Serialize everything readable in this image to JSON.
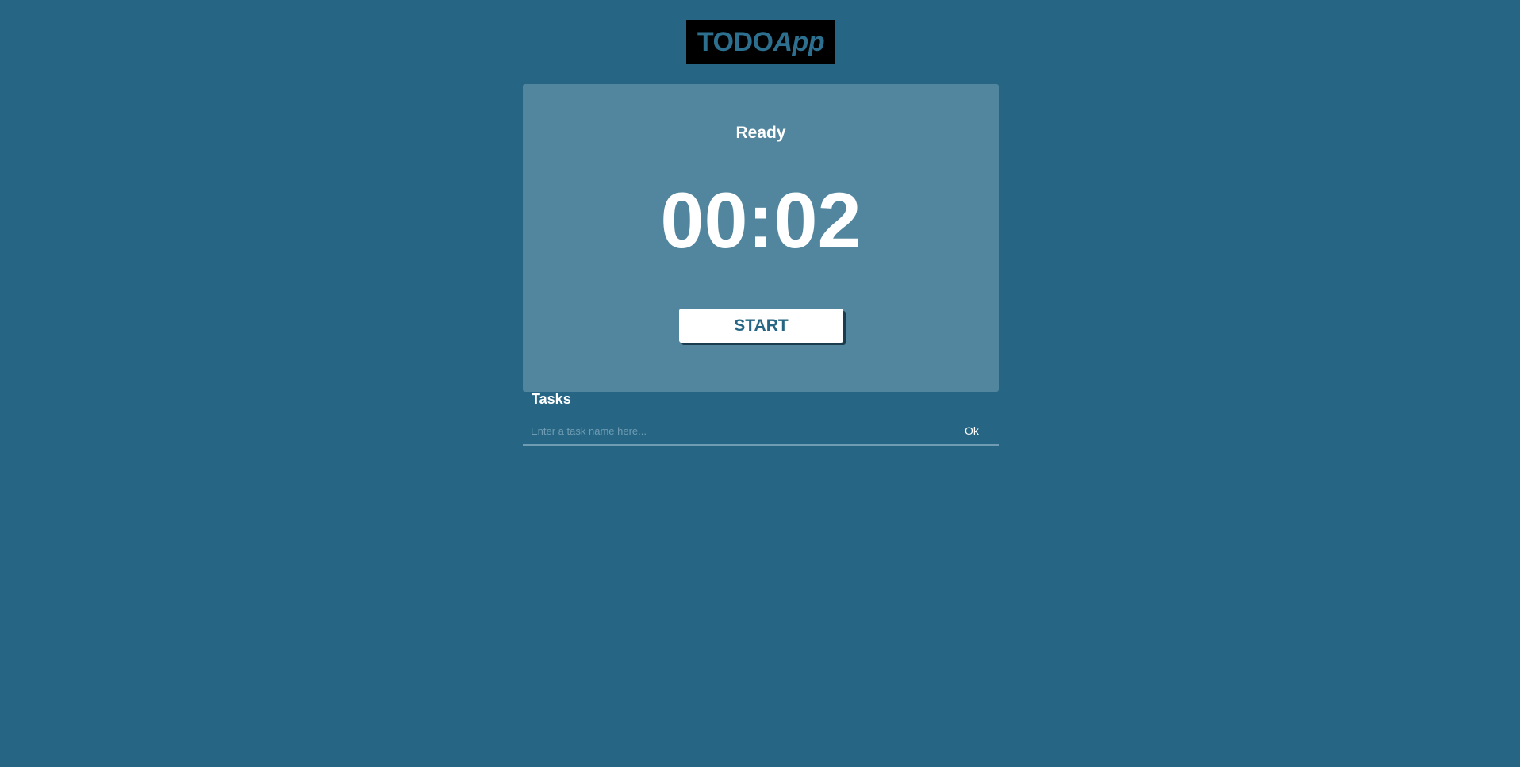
{
  "logo": {
    "todo": "TODO",
    "app": "App"
  },
  "timer": {
    "status": "Ready",
    "time": "00:02",
    "start_label": "START"
  },
  "tasks": {
    "title": "Tasks",
    "input_placeholder": "Enter a task name here...",
    "input_value": "",
    "ok_label": "Ok"
  },
  "colors": {
    "background": "#266684",
    "card": "#52869e",
    "accent": "#266684",
    "logo_bg": "#000000"
  }
}
